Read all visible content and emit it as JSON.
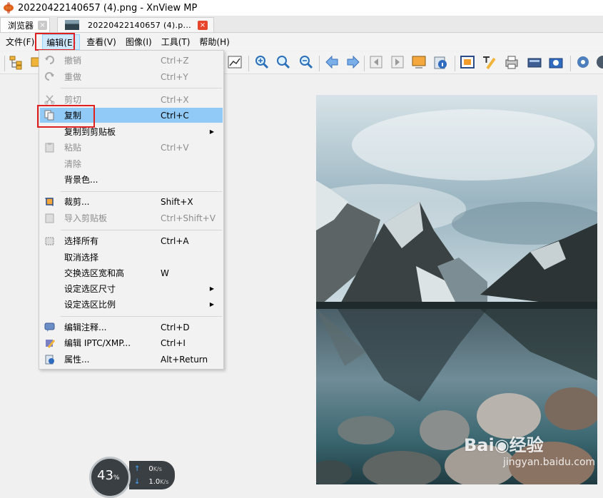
{
  "window": {
    "title": "20220422140657 (4).png - XnView MP"
  },
  "tabs": [
    {
      "label": "浏览器",
      "close": "×"
    },
    {
      "label": "20220422140657 (4).p...",
      "close": "×"
    }
  ],
  "menubar": [
    {
      "label": "文件(F)"
    },
    {
      "label": "编辑(E)"
    },
    {
      "label": "查看(V)"
    },
    {
      "label": "图像(I)"
    },
    {
      "label": "工具(T)"
    },
    {
      "label": "帮助(H)"
    }
  ],
  "edit_menu": [
    {
      "label": "撤销",
      "shortcut": "Ctrl+Z",
      "icon": "undo-icon"
    },
    {
      "label": "重做",
      "shortcut": "Ctrl+Y",
      "icon": "redo-icon"
    },
    {
      "label": "剪切",
      "shortcut": "Ctrl+X",
      "icon": "cut-icon"
    },
    {
      "label": "复制",
      "shortcut": "Ctrl+C",
      "icon": "copy-icon"
    },
    {
      "label": "复制到剪贴板",
      "shortcut": "",
      "icon": ""
    },
    {
      "label": "粘贴",
      "shortcut": "Ctrl+V",
      "icon": "paste-icon"
    },
    {
      "label": "清除",
      "shortcut": "",
      "icon": ""
    },
    {
      "label": "背景色...",
      "shortcut": "",
      "icon": ""
    },
    {
      "label": "裁剪...",
      "shortcut": "Shift+X",
      "icon": "crop-icon"
    },
    {
      "label": "导入剪贴板",
      "shortcut": "Ctrl+Shift+V",
      "icon": "import-clipboard-icon"
    },
    {
      "label": "选择所有",
      "shortcut": "Ctrl+A",
      "icon": "select-all-icon"
    },
    {
      "label": "取消选择",
      "shortcut": "",
      "icon": ""
    },
    {
      "label": "交换选区宽和高",
      "shortcut": "W",
      "icon": ""
    },
    {
      "label": "设定选区尺寸",
      "shortcut": "",
      "icon": ""
    },
    {
      "label": "设定选区比例",
      "shortcut": "",
      "icon": ""
    },
    {
      "label": "编辑注释...",
      "shortcut": "Ctrl+D",
      "icon": "comment-icon"
    },
    {
      "label": "编辑 IPTC/XMP...",
      "shortcut": "Ctrl+I",
      "icon": "iptc-icon"
    },
    {
      "label": "属性...",
      "shortcut": "Alt+Return",
      "icon": "properties-icon"
    }
  ],
  "system_widget": {
    "cpu_percent": "43",
    "cpu_unit": "%",
    "upload_value": "0",
    "upload_unit": "K/s",
    "download_value": "1.0",
    "download_unit": "K/s"
  },
  "watermark": {
    "brand": "Bai◉经验",
    "url": "jingyan.baidu.com"
  }
}
